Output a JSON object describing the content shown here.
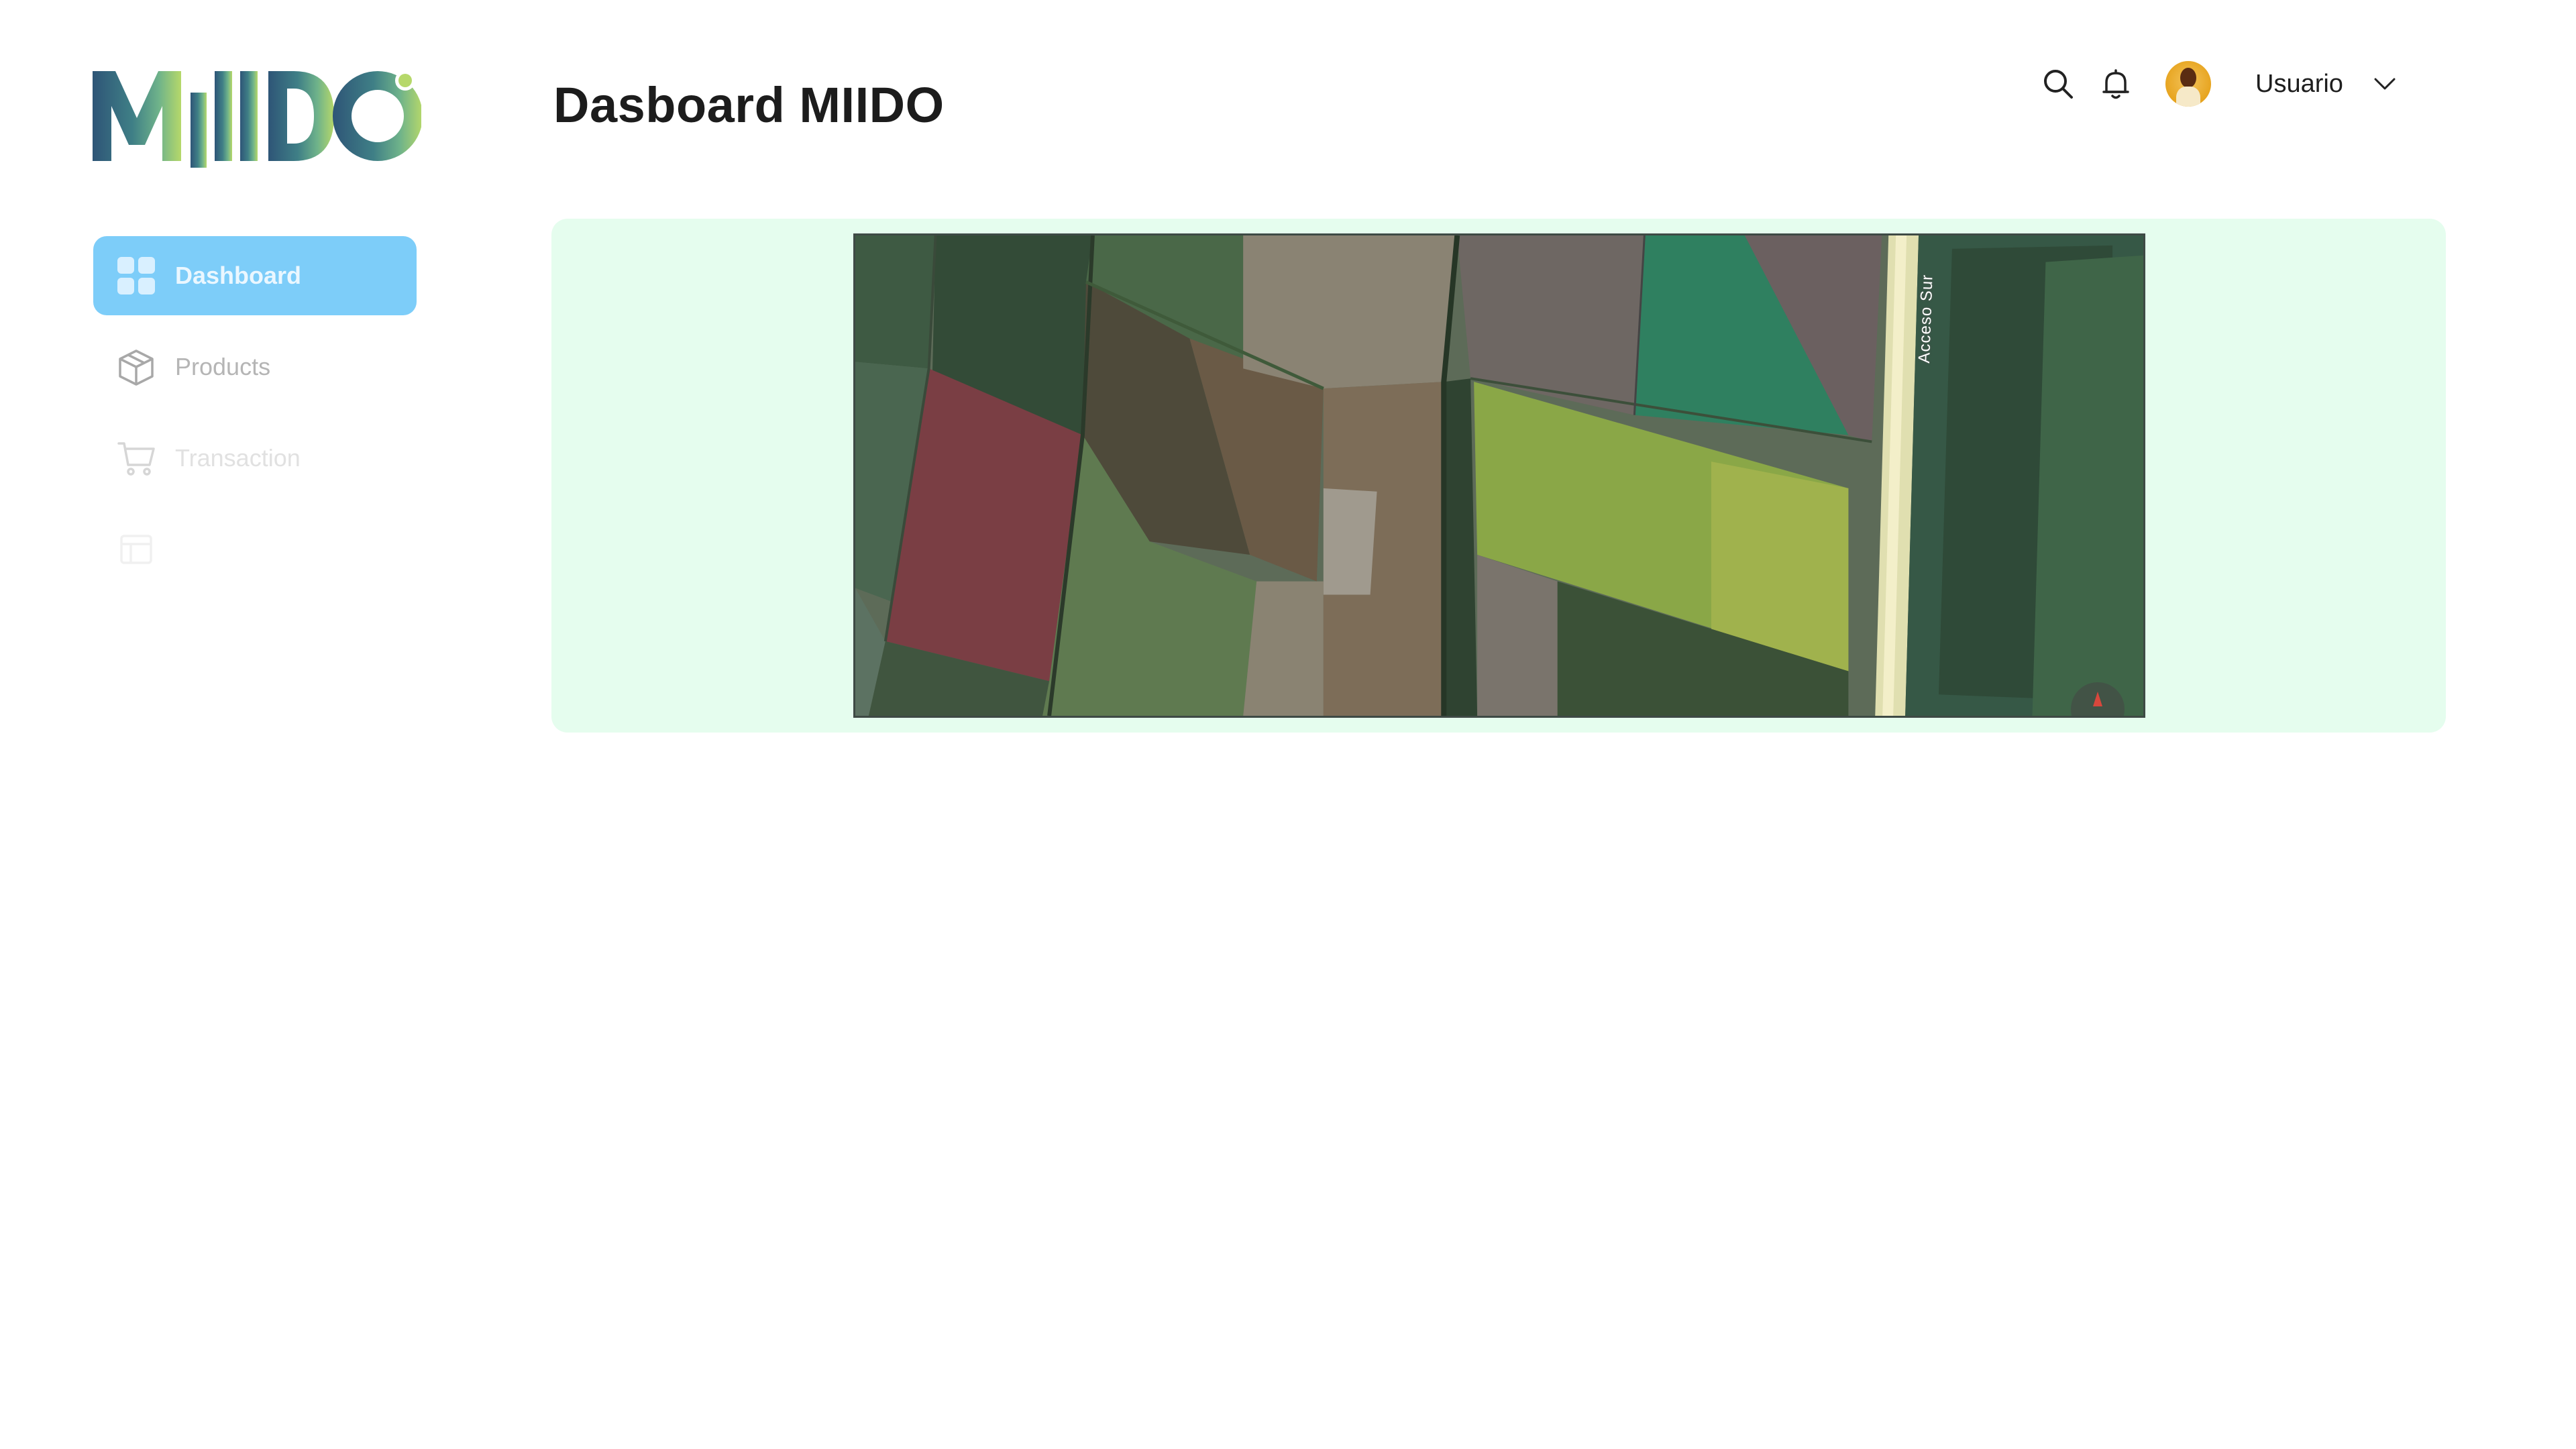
{
  "app": {
    "logo_text": "MIIDO",
    "page_title": "Dasboard MIIDO"
  },
  "sidebar": {
    "items": [
      {
        "label": "Dashboard",
        "icon": "dashboard-grid-icon",
        "active": true
      },
      {
        "label": "Products",
        "icon": "box-icon",
        "active": false
      },
      {
        "label": "Transaction",
        "icon": "cart-icon",
        "active": false
      },
      {
        "label": "",
        "icon": "report-icon",
        "active": false
      }
    ]
  },
  "header": {
    "icons": [
      "search-icon",
      "bell-icon"
    ],
    "user_name": "Usuario"
  },
  "map": {
    "road_label": "Acceso Sur"
  },
  "colors": {
    "accent_active": "#7dcdf9",
    "card_background": "#e5fdee",
    "logo_gradient_start": "#2e5577",
    "logo_gradient_end": "#b6d86a"
  }
}
